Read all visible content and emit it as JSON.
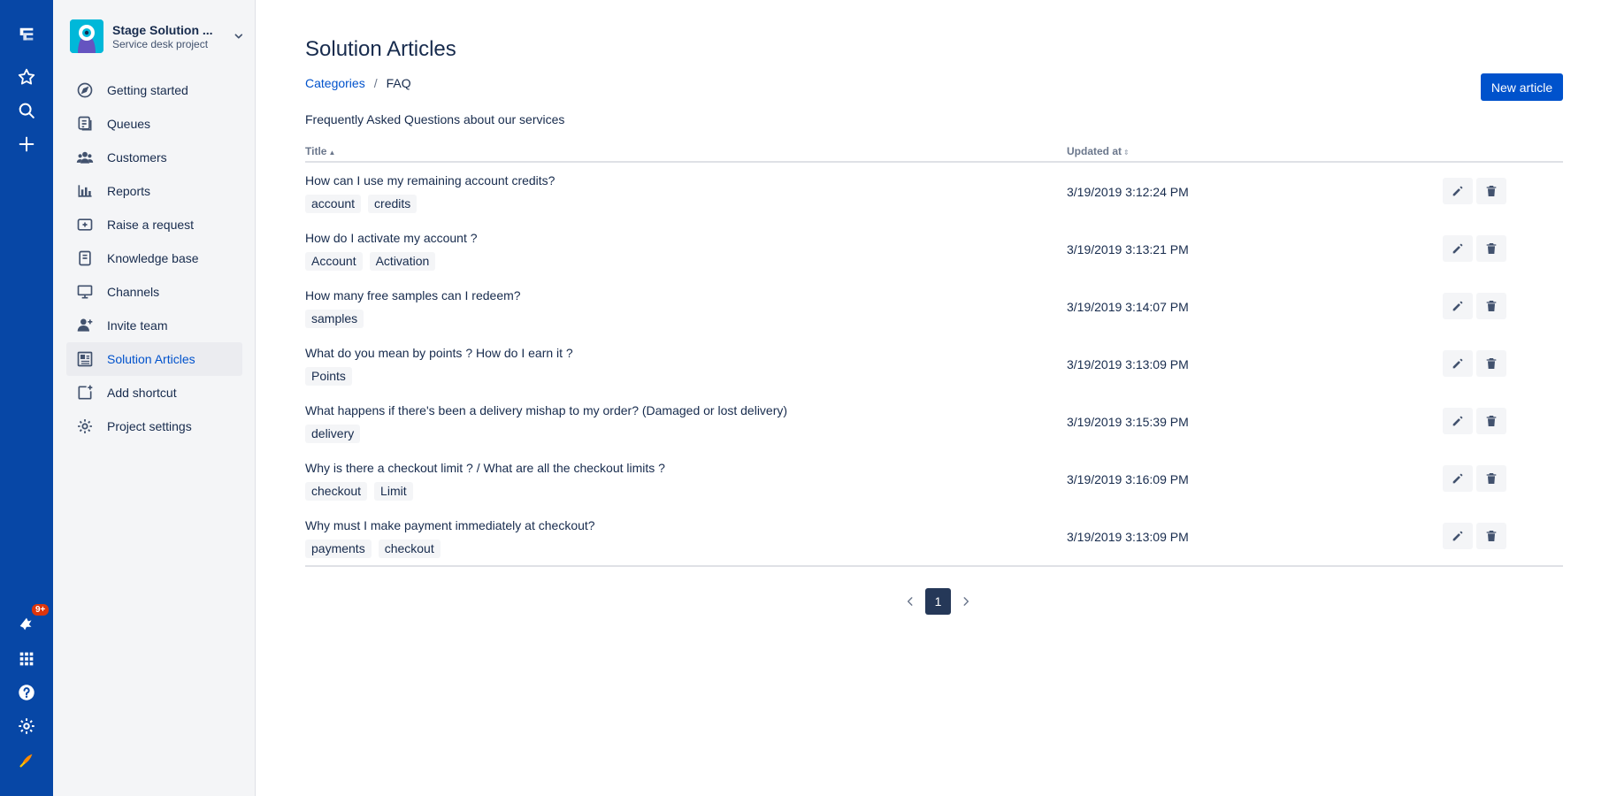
{
  "global_nav": {
    "top_icons": [
      "jira-logo-icon",
      "star-icon",
      "search-icon",
      "plus-icon"
    ],
    "bottom_icons": [
      "notifications-icon",
      "app-switcher-icon",
      "help-icon",
      "settings-icon",
      "profile-avatar-icon"
    ],
    "notification_badge": "9+"
  },
  "project": {
    "name": "Stage Solution ...",
    "type": "Service desk project"
  },
  "sidebar": {
    "items": [
      {
        "label": "Getting started",
        "icon": "compass-icon"
      },
      {
        "label": "Queues",
        "icon": "queues-icon"
      },
      {
        "label": "Customers",
        "icon": "customers-icon"
      },
      {
        "label": "Reports",
        "icon": "reports-icon"
      },
      {
        "label": "Raise a request",
        "icon": "raise-request-icon"
      },
      {
        "label": "Knowledge base",
        "icon": "knowledge-base-icon"
      },
      {
        "label": "Channels",
        "icon": "channels-icon"
      },
      {
        "label": "Invite team",
        "icon": "invite-team-icon"
      },
      {
        "label": "Solution Articles",
        "icon": "solution-articles-icon",
        "active": true
      },
      {
        "label": "Add shortcut",
        "icon": "add-shortcut-icon"
      },
      {
        "label": "Project settings",
        "icon": "gear-icon"
      }
    ]
  },
  "main": {
    "title": "Solution Articles",
    "breadcrumb": {
      "link": "Categories",
      "separator": "/",
      "current": "FAQ"
    },
    "new_article_label": "New article",
    "description": "Frequently Asked Questions about our services",
    "table": {
      "headers": {
        "title": "Title",
        "updated": "Updated at"
      },
      "rows": [
        {
          "title": "How can I use my remaining account credits?",
          "tags": [
            "account",
            "credits"
          ],
          "updated": "3/19/2019 3:12:24 PM"
        },
        {
          "title": "How do I activate my account ?",
          "tags": [
            "Account",
            "Activation"
          ],
          "updated": "3/19/2019 3:13:21 PM"
        },
        {
          "title": "How many free samples can I redeem?",
          "tags": [
            "samples"
          ],
          "updated": "3/19/2019 3:14:07 PM"
        },
        {
          "title": "What do you mean by points ? How do I earn it ?",
          "tags": [
            "Points"
          ],
          "updated": "3/19/2019 3:13:09 PM"
        },
        {
          "title": "What happens if there's been a delivery mishap to my order? (Damaged or lost delivery)",
          "tags": [
            "delivery"
          ],
          "updated": "3/19/2019 3:15:39 PM"
        },
        {
          "title": "Why is there a checkout limit ? / What are all the checkout limits ?",
          "tags": [
            "checkout",
            "Limit"
          ],
          "updated": "3/19/2019 3:16:09 PM"
        },
        {
          "title": "Why must I make payment immediately at checkout?",
          "tags": [
            "payments",
            "checkout"
          ],
          "updated": "3/19/2019 3:13:09 PM"
        }
      ]
    },
    "pagination": {
      "current_page": "1"
    }
  },
  "colors": {
    "global_nav_bg": "#0747a6",
    "primary": "#0052cc",
    "text": "#172b4d",
    "sidebar_bg": "#f4f5f7",
    "badge": "#de350b"
  }
}
